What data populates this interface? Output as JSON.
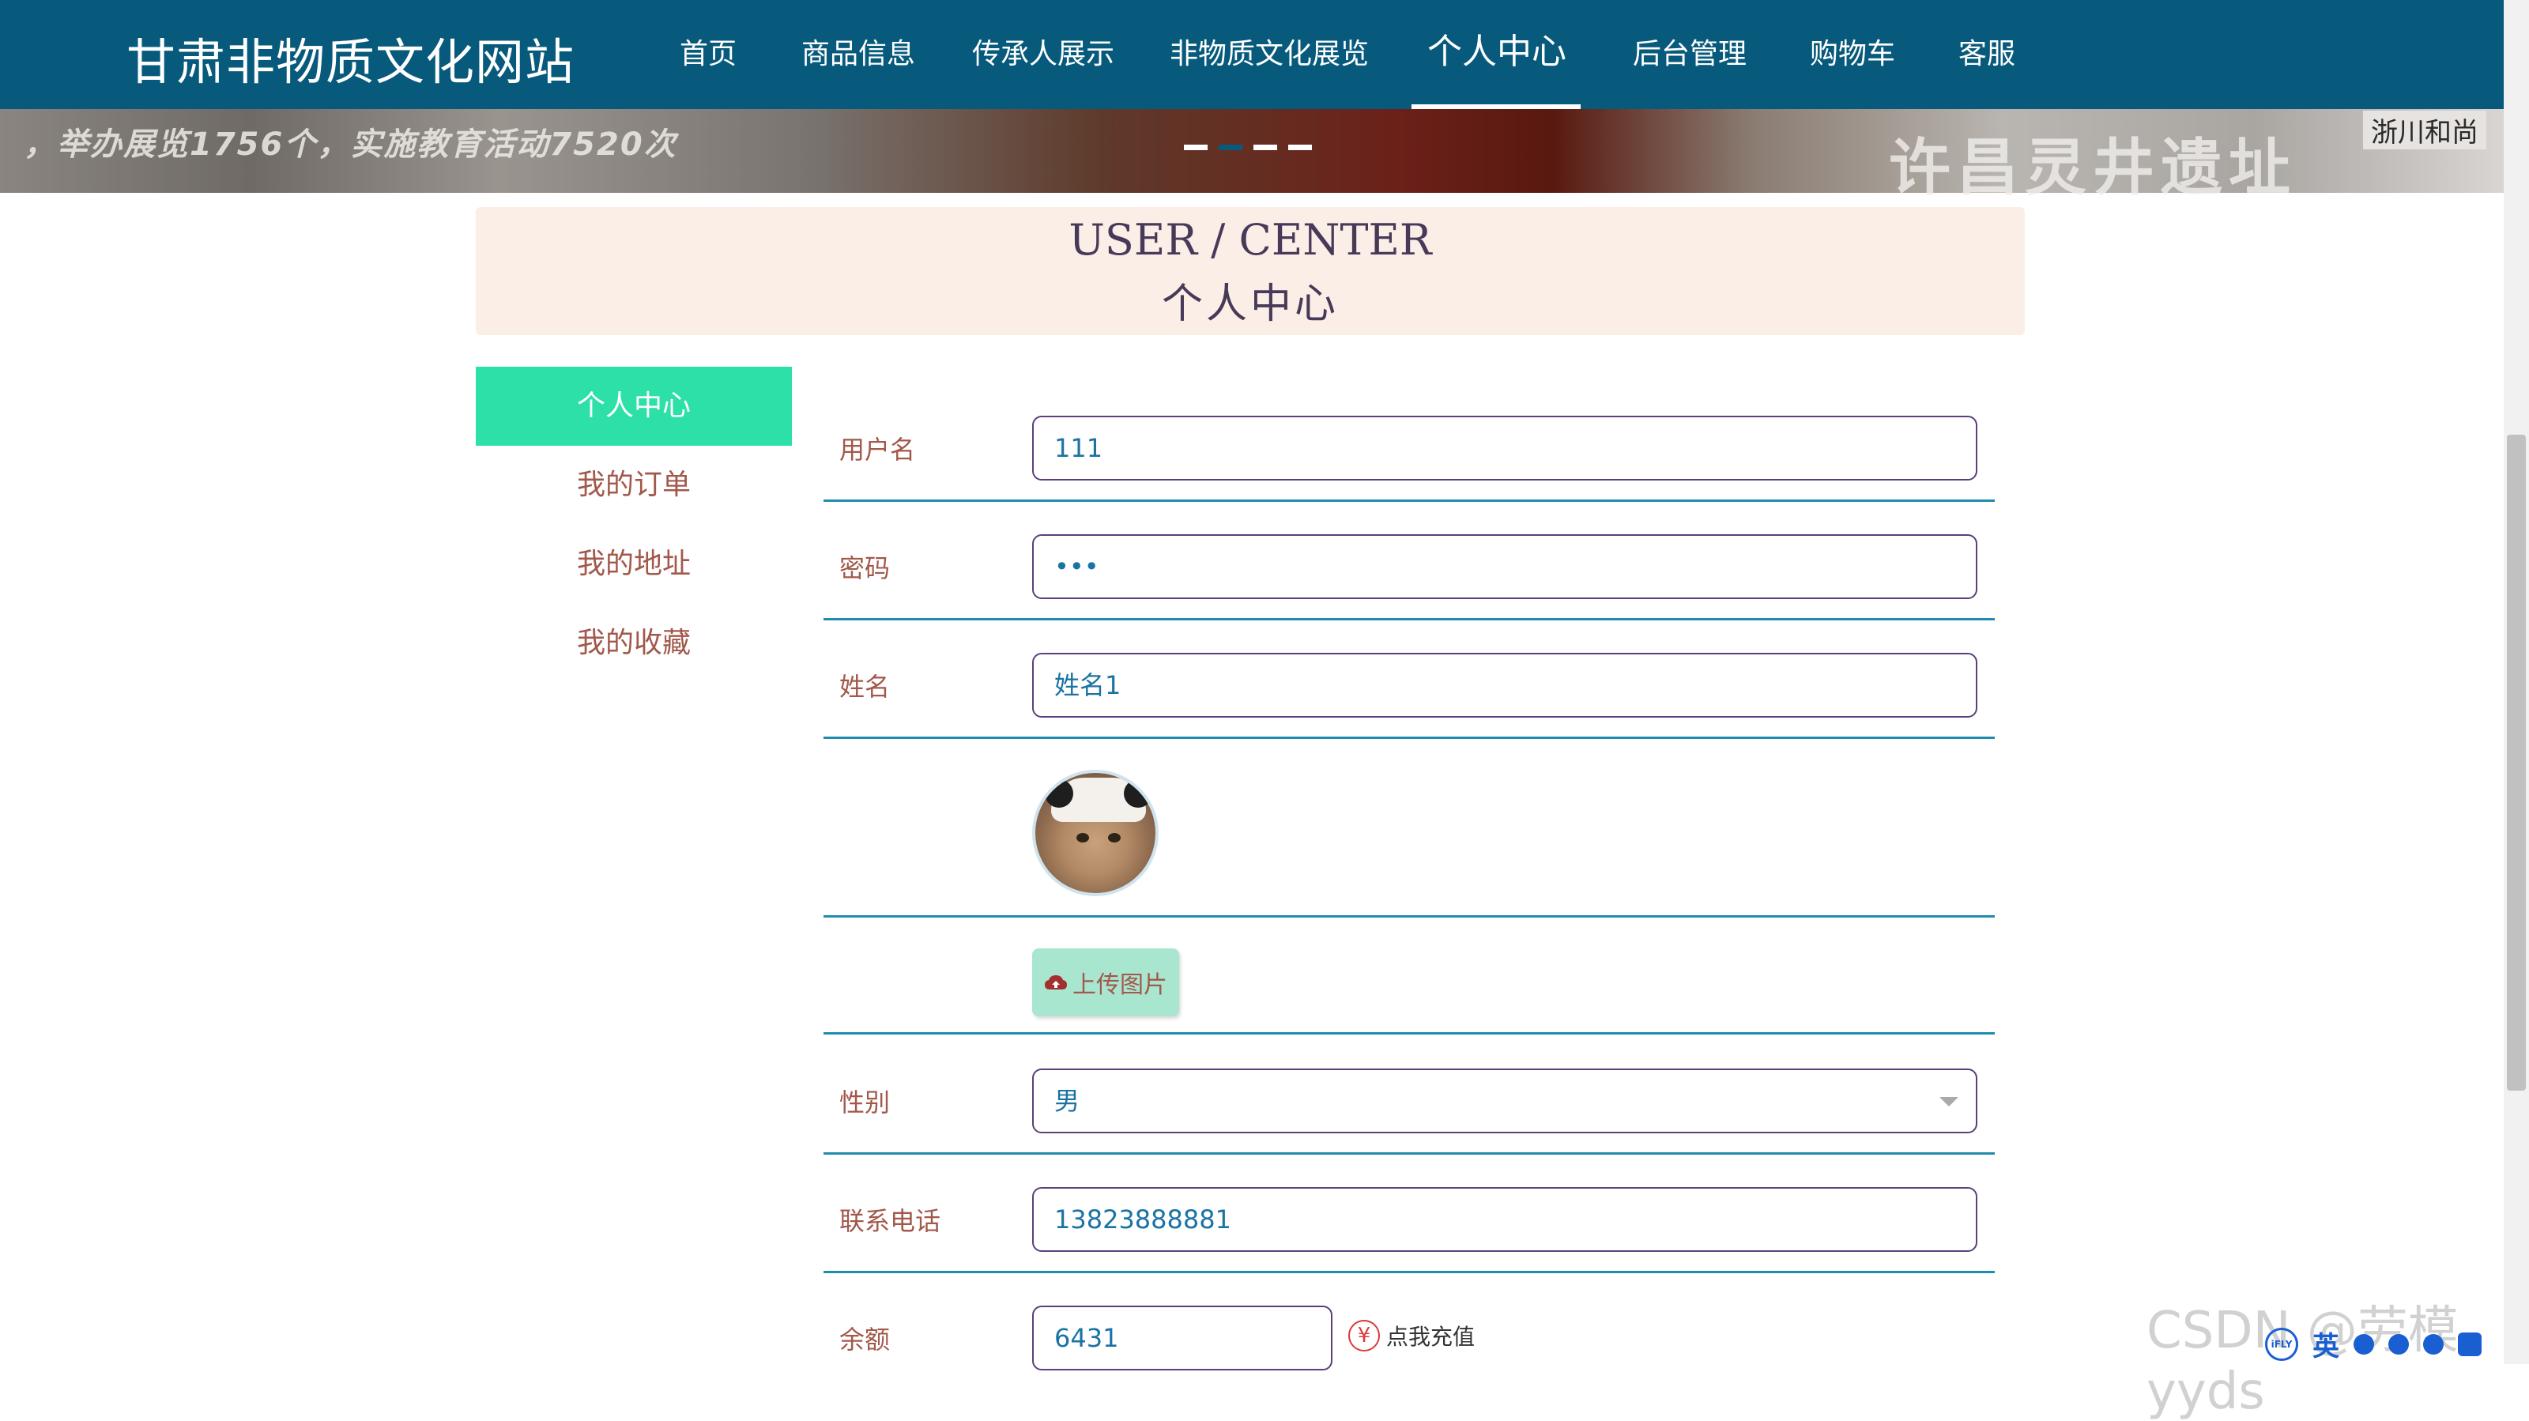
{
  "site": {
    "title": "甘肃非物质文化网站"
  },
  "nav": {
    "items": [
      {
        "label": "首页"
      },
      {
        "label": "商品信息"
      },
      {
        "label": "传承人展示"
      },
      {
        "label": "非物质文化展览"
      },
      {
        "label": "个人中心",
        "active": true
      },
      {
        "label": "后台管理"
      },
      {
        "label": "购物车"
      },
      {
        "label": "客服"
      }
    ]
  },
  "banner": {
    "text_left": "，举办展览1756个，实施教育活动7520次",
    "text_right": "许昌灵井遗址",
    "text_far": "浙川和尚",
    "slides_total": 4,
    "slide_active": 2
  },
  "heading": {
    "en": "USER / CENTER",
    "cn": "个人中心"
  },
  "sidebar": {
    "items": [
      {
        "label": "个人中心",
        "active": true
      },
      {
        "label": "我的订单"
      },
      {
        "label": "我的地址"
      },
      {
        "label": "我的收藏"
      }
    ]
  },
  "form": {
    "username": {
      "label": "用户名",
      "value": "111"
    },
    "password": {
      "label": "密码",
      "value": "•••"
    },
    "name": {
      "label": "姓名",
      "value": "姓名1"
    },
    "upload": {
      "label": "上传图片"
    },
    "gender": {
      "label": "性别",
      "value": "男"
    },
    "phone": {
      "label": "联系电话",
      "value": "13823888881"
    },
    "balance": {
      "label": "余额",
      "value": "6431"
    },
    "recharge": {
      "label": "点我充值",
      "icon": "yen-icon"
    }
  },
  "overlay": {
    "watermark": "CSDN @劳模yyds",
    "ime_logo": "iFLY",
    "ime_lang": "英"
  },
  "colors": {
    "nav_bg": "#075a7b",
    "accent_green": "#2de0a8",
    "label_brown": "#a2584b",
    "field_border": "#5b3f7a",
    "row_line": "#1f8bae",
    "heading_bg": "#fbeee7"
  }
}
